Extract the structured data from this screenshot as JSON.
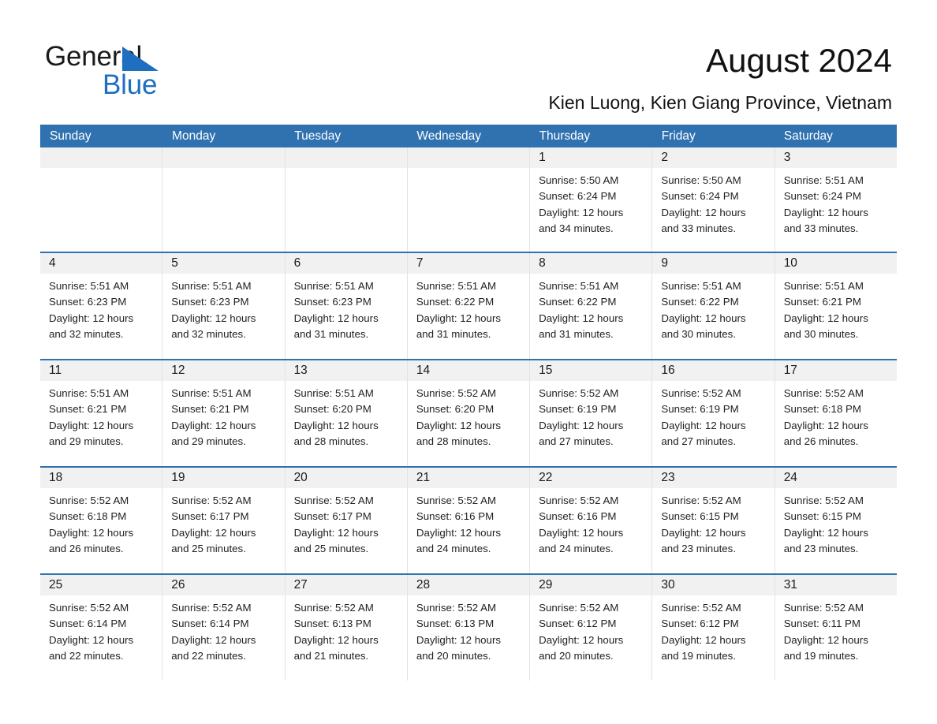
{
  "brand": {
    "line1": "General",
    "line2": "Blue",
    "triangle_color": "#1f6fc0",
    "text_color": "#1a1a1a"
  },
  "header": {
    "title": "August 2024",
    "subtitle": "Kien Luong, Kien Giang Province, Vietnam",
    "accent_color": "#3071b0"
  },
  "calendar": {
    "weekday_headers": [
      "Sunday",
      "Monday",
      "Tuesday",
      "Wednesday",
      "Thursday",
      "Friday",
      "Saturday"
    ],
    "weeks": [
      [
        {
          "day": "",
          "sunrise": "",
          "sunset": "",
          "daylight1": "",
          "daylight2": ""
        },
        {
          "day": "",
          "sunrise": "",
          "sunset": "",
          "daylight1": "",
          "daylight2": ""
        },
        {
          "day": "",
          "sunrise": "",
          "sunset": "",
          "daylight1": "",
          "daylight2": ""
        },
        {
          "day": "",
          "sunrise": "",
          "sunset": "",
          "daylight1": "",
          "daylight2": ""
        },
        {
          "day": "1",
          "sunrise": "Sunrise: 5:50 AM",
          "sunset": "Sunset: 6:24 PM",
          "daylight1": "Daylight: 12 hours",
          "daylight2": "and 34 minutes."
        },
        {
          "day": "2",
          "sunrise": "Sunrise: 5:50 AM",
          "sunset": "Sunset: 6:24 PM",
          "daylight1": "Daylight: 12 hours",
          "daylight2": "and 33 minutes."
        },
        {
          "day": "3",
          "sunrise": "Sunrise: 5:51 AM",
          "sunset": "Sunset: 6:24 PM",
          "daylight1": "Daylight: 12 hours",
          "daylight2": "and 33 minutes."
        }
      ],
      [
        {
          "day": "4",
          "sunrise": "Sunrise: 5:51 AM",
          "sunset": "Sunset: 6:23 PM",
          "daylight1": "Daylight: 12 hours",
          "daylight2": "and 32 minutes."
        },
        {
          "day": "5",
          "sunrise": "Sunrise: 5:51 AM",
          "sunset": "Sunset: 6:23 PM",
          "daylight1": "Daylight: 12 hours",
          "daylight2": "and 32 minutes."
        },
        {
          "day": "6",
          "sunrise": "Sunrise: 5:51 AM",
          "sunset": "Sunset: 6:23 PM",
          "daylight1": "Daylight: 12 hours",
          "daylight2": "and 31 minutes."
        },
        {
          "day": "7",
          "sunrise": "Sunrise: 5:51 AM",
          "sunset": "Sunset: 6:22 PM",
          "daylight1": "Daylight: 12 hours",
          "daylight2": "and 31 minutes."
        },
        {
          "day": "8",
          "sunrise": "Sunrise: 5:51 AM",
          "sunset": "Sunset: 6:22 PM",
          "daylight1": "Daylight: 12 hours",
          "daylight2": "and 31 minutes."
        },
        {
          "day": "9",
          "sunrise": "Sunrise: 5:51 AM",
          "sunset": "Sunset: 6:22 PM",
          "daylight1": "Daylight: 12 hours",
          "daylight2": "and 30 minutes."
        },
        {
          "day": "10",
          "sunrise": "Sunrise: 5:51 AM",
          "sunset": "Sunset: 6:21 PM",
          "daylight1": "Daylight: 12 hours",
          "daylight2": "and 30 minutes."
        }
      ],
      [
        {
          "day": "11",
          "sunrise": "Sunrise: 5:51 AM",
          "sunset": "Sunset: 6:21 PM",
          "daylight1": "Daylight: 12 hours",
          "daylight2": "and 29 minutes."
        },
        {
          "day": "12",
          "sunrise": "Sunrise: 5:51 AM",
          "sunset": "Sunset: 6:21 PM",
          "daylight1": "Daylight: 12 hours",
          "daylight2": "and 29 minutes."
        },
        {
          "day": "13",
          "sunrise": "Sunrise: 5:51 AM",
          "sunset": "Sunset: 6:20 PM",
          "daylight1": "Daylight: 12 hours",
          "daylight2": "and 28 minutes."
        },
        {
          "day": "14",
          "sunrise": "Sunrise: 5:52 AM",
          "sunset": "Sunset: 6:20 PM",
          "daylight1": "Daylight: 12 hours",
          "daylight2": "and 28 minutes."
        },
        {
          "day": "15",
          "sunrise": "Sunrise: 5:52 AM",
          "sunset": "Sunset: 6:19 PM",
          "daylight1": "Daylight: 12 hours",
          "daylight2": "and 27 minutes."
        },
        {
          "day": "16",
          "sunrise": "Sunrise: 5:52 AM",
          "sunset": "Sunset: 6:19 PM",
          "daylight1": "Daylight: 12 hours",
          "daylight2": "and 27 minutes."
        },
        {
          "day": "17",
          "sunrise": "Sunrise: 5:52 AM",
          "sunset": "Sunset: 6:18 PM",
          "daylight1": "Daylight: 12 hours",
          "daylight2": "and 26 minutes."
        }
      ],
      [
        {
          "day": "18",
          "sunrise": "Sunrise: 5:52 AM",
          "sunset": "Sunset: 6:18 PM",
          "daylight1": "Daylight: 12 hours",
          "daylight2": "and 26 minutes."
        },
        {
          "day": "19",
          "sunrise": "Sunrise: 5:52 AM",
          "sunset": "Sunset: 6:17 PM",
          "daylight1": "Daylight: 12 hours",
          "daylight2": "and 25 minutes."
        },
        {
          "day": "20",
          "sunrise": "Sunrise: 5:52 AM",
          "sunset": "Sunset: 6:17 PM",
          "daylight1": "Daylight: 12 hours",
          "daylight2": "and 25 minutes."
        },
        {
          "day": "21",
          "sunrise": "Sunrise: 5:52 AM",
          "sunset": "Sunset: 6:16 PM",
          "daylight1": "Daylight: 12 hours",
          "daylight2": "and 24 minutes."
        },
        {
          "day": "22",
          "sunrise": "Sunrise: 5:52 AM",
          "sunset": "Sunset: 6:16 PM",
          "daylight1": "Daylight: 12 hours",
          "daylight2": "and 24 minutes."
        },
        {
          "day": "23",
          "sunrise": "Sunrise: 5:52 AM",
          "sunset": "Sunset: 6:15 PM",
          "daylight1": "Daylight: 12 hours",
          "daylight2": "and 23 minutes."
        },
        {
          "day": "24",
          "sunrise": "Sunrise: 5:52 AM",
          "sunset": "Sunset: 6:15 PM",
          "daylight1": "Daylight: 12 hours",
          "daylight2": "and 23 minutes."
        }
      ],
      [
        {
          "day": "25",
          "sunrise": "Sunrise: 5:52 AM",
          "sunset": "Sunset: 6:14 PM",
          "daylight1": "Daylight: 12 hours",
          "daylight2": "and 22 minutes."
        },
        {
          "day": "26",
          "sunrise": "Sunrise: 5:52 AM",
          "sunset": "Sunset: 6:14 PM",
          "daylight1": "Daylight: 12 hours",
          "daylight2": "and 22 minutes."
        },
        {
          "day": "27",
          "sunrise": "Sunrise: 5:52 AM",
          "sunset": "Sunset: 6:13 PM",
          "daylight1": "Daylight: 12 hours",
          "daylight2": "and 21 minutes."
        },
        {
          "day": "28",
          "sunrise": "Sunrise: 5:52 AM",
          "sunset": "Sunset: 6:13 PM",
          "daylight1": "Daylight: 12 hours",
          "daylight2": "and 20 minutes."
        },
        {
          "day": "29",
          "sunrise": "Sunrise: 5:52 AM",
          "sunset": "Sunset: 6:12 PM",
          "daylight1": "Daylight: 12 hours",
          "daylight2": "and 20 minutes."
        },
        {
          "day": "30",
          "sunrise": "Sunrise: 5:52 AM",
          "sunset": "Sunset: 6:12 PM",
          "daylight1": "Daylight: 12 hours",
          "daylight2": "and 19 minutes."
        },
        {
          "day": "31",
          "sunrise": "Sunrise: 5:52 AM",
          "sunset": "Sunset: 6:11 PM",
          "daylight1": "Daylight: 12 hours",
          "daylight2": "and 19 minutes."
        }
      ]
    ]
  }
}
